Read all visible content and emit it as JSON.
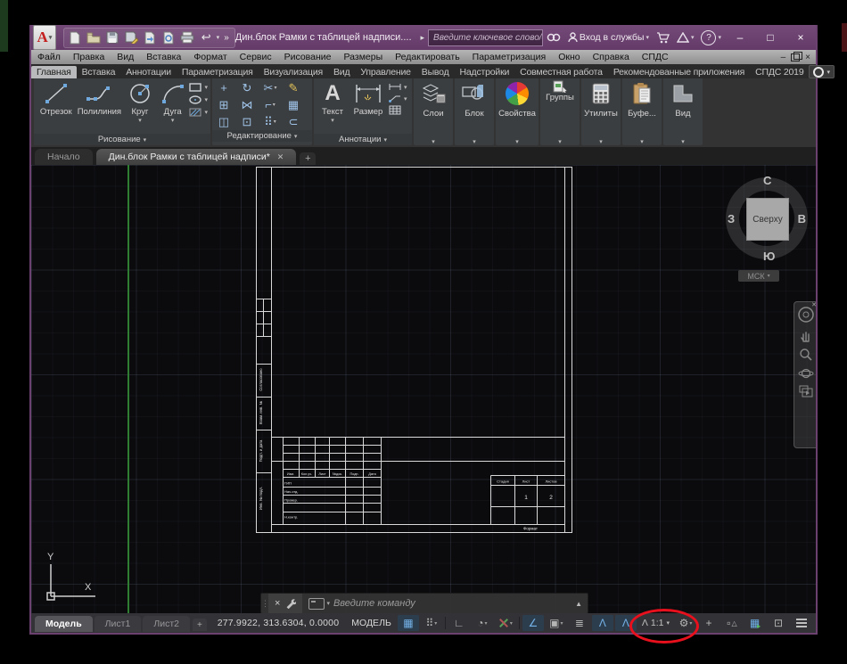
{
  "titlebar": {
    "logo_letter": "A",
    "title": "Дин.блок Рамки с таблицей надписи....",
    "search_placeholder": "Введите ключевое слово/фразу",
    "signin_label": "Вход в службы",
    "help_glyph": "?",
    "minimize": "–",
    "maximize": "□",
    "close": "×"
  },
  "menubar": {
    "items": [
      "Файл",
      "Правка",
      "Вид",
      "Вставка",
      "Формат",
      "Сервис",
      "Рисование",
      "Размеры",
      "Редактировать",
      "Параметризация",
      "Окно",
      "Справка",
      "СПДС"
    ],
    "doc_minimize": "–",
    "doc_close": "×"
  },
  "ribbon": {
    "tabs": [
      "Главная",
      "Вставка",
      "Аннотации",
      "Параметризация",
      "Визуализация",
      "Вид",
      "Управление",
      "Вывод",
      "Надстройки",
      "Совместная работа",
      "Рекомендованные приложения",
      "СПДС 2019"
    ],
    "draw_panel": {
      "label": "Рисование",
      "b1": "Отрезок",
      "b2": "Полилиния",
      "b3": "Круг",
      "b4": "Дуга"
    },
    "edit_panel": {
      "label": "Редактирование"
    },
    "annot_panel": {
      "label": "Аннотации",
      "b1": "Текст",
      "b2": "Размер",
      "a_glyph": "A"
    },
    "p_layers": "Слои",
    "p_block": "Блок",
    "p_props": "Свойства",
    "p_groups": "Группы",
    "p_utils": "Утилиты",
    "p_clip": "Буфе...",
    "p_view": "Вид"
  },
  "file_tabs": {
    "start_tab": "Начало",
    "active_tab": "Дин.блок Рамки с таблицей надписи*",
    "close_glyph": "✕",
    "plus": "+"
  },
  "drawing": {
    "stamp": {
      "side_agreed": "Согласовано",
      "side_replace": "Взам. инв. №",
      "side_sign": "Подп. и дата",
      "side_inv": "Инв. № подл.",
      "h1": "Изм.",
      "h2": "Кол.уч.",
      "h3": "Лист",
      "h4": "№док.",
      "h5": "Подп.",
      "h6": "Дата",
      "r1": "ГИП",
      "r2": "Нач.отд.",
      "r3": "Провер.",
      "r4": "Н.контр.",
      "stage": "Стадия",
      "sheet": "Лист",
      "sheets": "Листов",
      "sheet_num": "1",
      "sheets_total": "2",
      "format_label": "Формат"
    }
  },
  "viewcube": {
    "north": "С",
    "south": "Ю",
    "west": "З",
    "east": "В",
    "center": "Сверху",
    "wcs": "МСК"
  },
  "ucs": {
    "x": "X",
    "y": "Y"
  },
  "command_line": {
    "placeholder": "Введите команду",
    "grip": "⋮",
    "close": "×",
    "up": "▲"
  },
  "statusbar": {
    "tab_model": "Модель",
    "tab_l1": "Лист1",
    "tab_l2": "Лист2",
    "plus": "+",
    "coords": "277.9922, 313.6304, 0.0000",
    "space_label": "МОДЕЛЬ",
    "scale_value": "1:1"
  },
  "icons": {
    "caret": "▾",
    "expand": "»",
    "undo": "↩",
    "flyout": "▸",
    "grid": "▦",
    "snap": "⠿",
    "ortho": "∟",
    "polar": "◔",
    "osnap": "∠",
    "osnap2d": "▣",
    "lineweight": "≣",
    "annot_vis": "Λ",
    "annot_auto": "Λ",
    "annot_scale": "Λ",
    "gear": "⚙",
    "crosshair": "+",
    "isolate": "▫",
    "cleanscreen": "⊡",
    "move": "+",
    "rotate": "↻",
    "trim": "✂",
    "erase": "✎",
    "copy": "⊞",
    "mirror": "⋈",
    "fillet": "⌐",
    "explode": "▦",
    "stretch": "◫",
    "scale": "⊡",
    "array": "⠿",
    "offset": "⊂",
    "cart": "🛒"
  },
  "colors": {
    "titlebar_purple": "#6b4170",
    "accent_blue": "#74b2e8",
    "highlight_red": "#e8101c",
    "green_line": "#2f7d32"
  }
}
